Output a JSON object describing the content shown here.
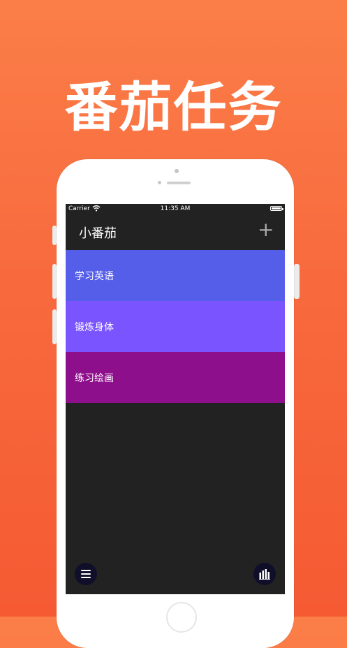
{
  "promo": {
    "headline": "番茄任务"
  },
  "status_bar": {
    "carrier": "Carrier",
    "time": "11:35 AM"
  },
  "nav": {
    "title": "小番茄",
    "add_label": "+"
  },
  "tasks": [
    {
      "label": "学习英语",
      "color": "#545ee8"
    },
    {
      "label": "锻炼身体",
      "color": "#7a55ff"
    },
    {
      "label": "练习绘画",
      "color": "#8e0f8c"
    }
  ],
  "icons": {
    "menu": "hamburger-menu-icon",
    "stats": "bar-chart-icon"
  },
  "colors": {
    "background": "#f86a3e",
    "screen": "#222222",
    "fab": "#0f0f2a"
  }
}
